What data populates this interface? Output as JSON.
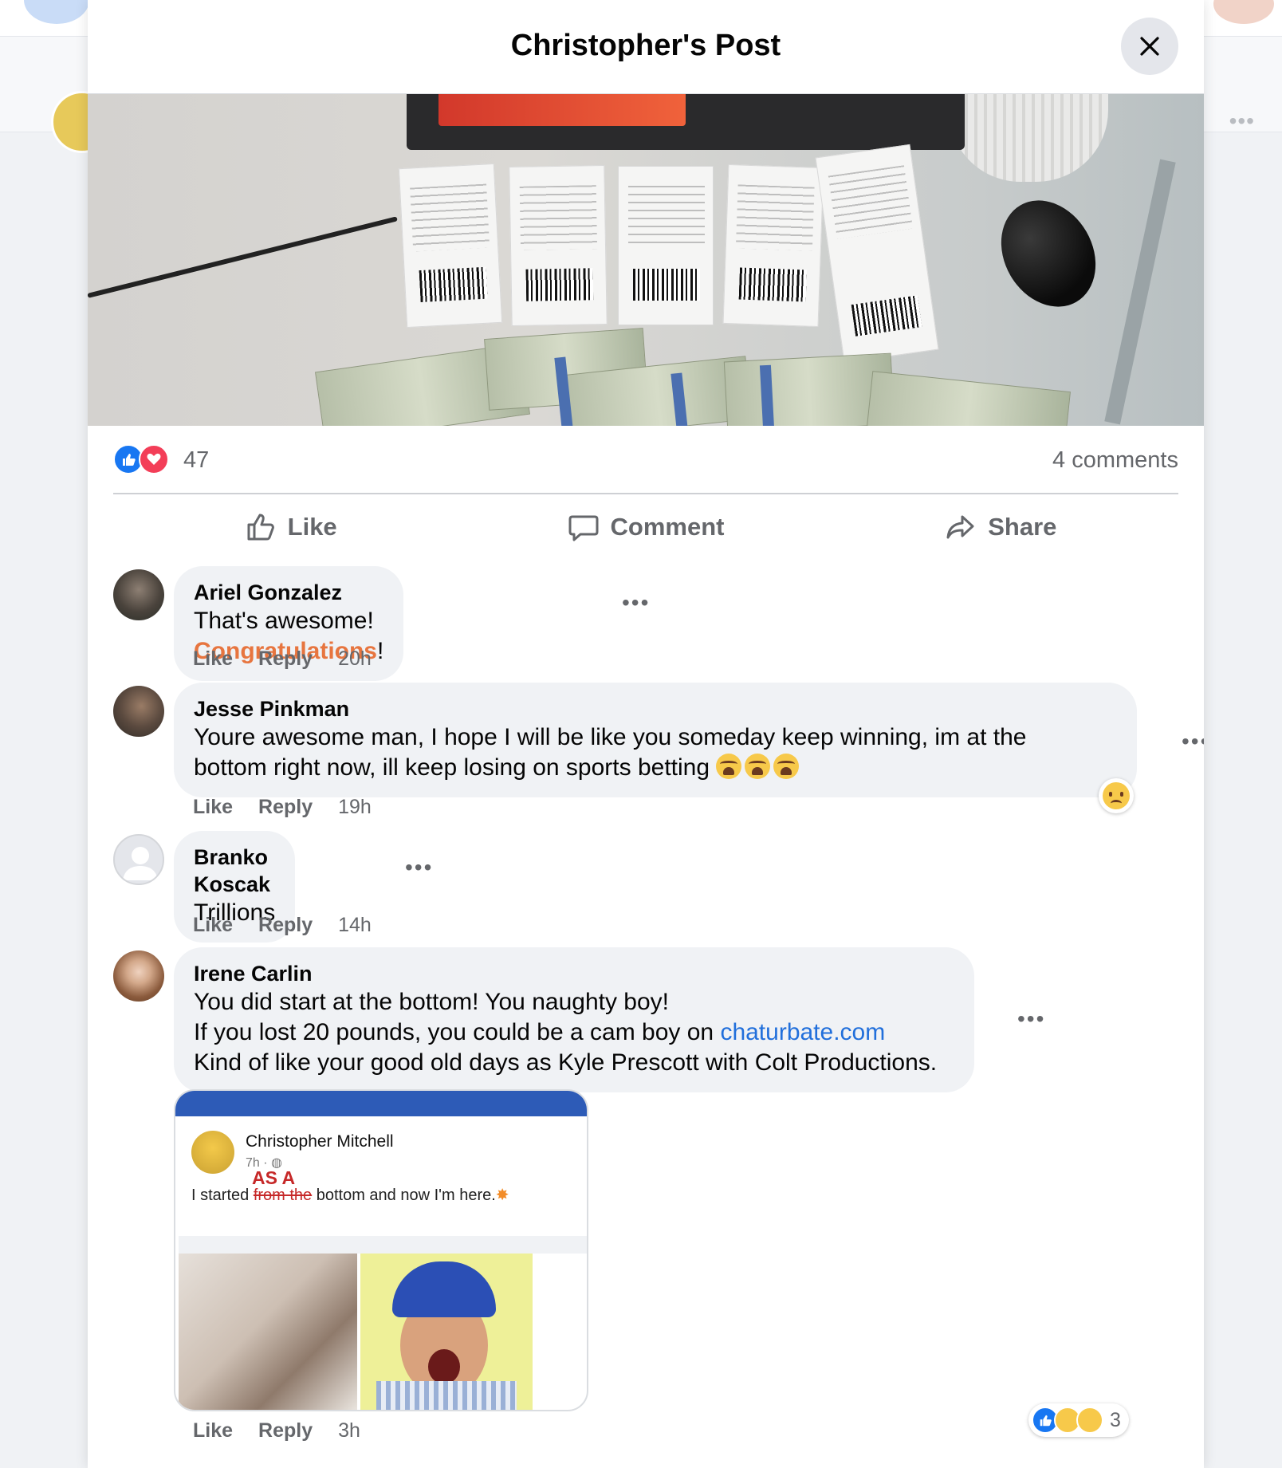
{
  "modal": {
    "title": "Christopher's Post",
    "close_icon": "close-icon"
  },
  "post": {
    "reaction_count": "47",
    "comment_count": "4 comments",
    "reaction_icons": [
      "like-icon",
      "love-icon"
    ]
  },
  "actions": {
    "like": "Like",
    "comment": "Comment",
    "share": "Share"
  },
  "comments": [
    {
      "name": "Ariel Gonzalez",
      "text_before": "That's awesome! ",
      "text_highlight": "Congratulations",
      "text_after": "!",
      "like": "Like",
      "reply": "Reply",
      "time": "20h"
    },
    {
      "name": "Jesse Pinkman",
      "text_line1": "Youre awesome man, I hope I will be like you someday keep winning, im at the",
      "text_line2": "bottom right now, ill keep losing on sports betting",
      "emojis": [
        "crying-face-icon",
        "crying-face-icon",
        "crying-face-icon"
      ],
      "reaction": "sad-icon",
      "like": "Like",
      "reply": "Reply",
      "time": "19h"
    },
    {
      "name": "Branko Koscak",
      "text": "Trillions",
      "like": "Like",
      "reply": "Reply",
      "time": "14h"
    },
    {
      "name": "Irene Carlin",
      "text_line1": "You did start at the bottom! You naughty boy!",
      "text_line2_before": "If you lost 20 pounds, you could be a cam boy on ",
      "text_line2_link": "chaturbate.com",
      "text_line3": "Kind of like your good old days as Kyle Prescott with Colt Productions.",
      "attachment": {
        "name": "Christopher Mitchell",
        "time": "7h ·",
        "text_before": "I started ",
        "text_struck": "from the",
        "text_after": " bottom and now I'm here.",
        "overwrite": "AS  A"
      },
      "reaction_count": "3",
      "reaction_icons": [
        "like-icon",
        "haha-icon",
        "wow-icon"
      ],
      "like": "Like",
      "reply": "Reply",
      "time": "3h"
    }
  ],
  "colors": {
    "facebook_blue": "#1877f2",
    "love_red": "#f33e58",
    "highlight_orange": "#e7753f",
    "link_blue": "#216fdb"
  }
}
